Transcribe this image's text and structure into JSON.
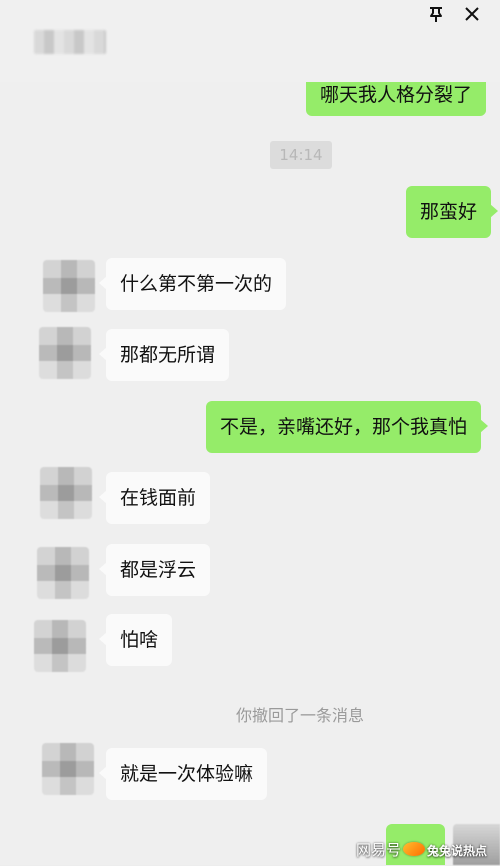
{
  "chat": {
    "contact_name": "",
    "timestamp": "14:14",
    "messages": [
      {
        "side": "right",
        "text": "哪天我人格分裂了"
      },
      {
        "side": "right",
        "text": "那蛮好"
      },
      {
        "side": "left",
        "text": "什么第不第一次的"
      },
      {
        "side": "left",
        "text": "那都无所谓"
      },
      {
        "side": "right",
        "text": "不是，亲嘴还好，那个我真怕"
      },
      {
        "side": "left",
        "text": "在钱面前"
      },
      {
        "side": "left",
        "text": "都是浮云"
      },
      {
        "side": "left",
        "text": "怕啥"
      },
      {
        "side": "left",
        "text": "就是一次体验嘛"
      }
    ],
    "recall_note": "你撤回了一条消息"
  },
  "watermark": {
    "left_text": "网易号",
    "right_text": "兔兔说热点"
  },
  "colors": {
    "background": "#efefef",
    "incoming_bubble": "#fafafa",
    "outgoing_bubble": "#95ec69"
  },
  "icons": {
    "pin": "pin-icon",
    "close": "close-icon"
  }
}
